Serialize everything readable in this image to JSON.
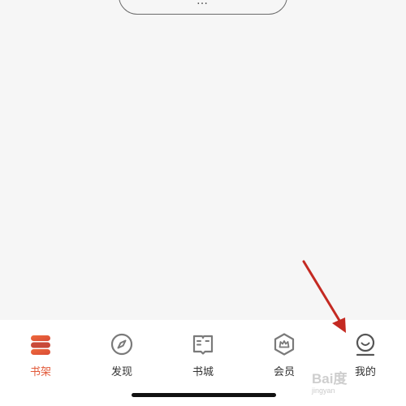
{
  "top_button": {
    "label": "…"
  },
  "tabbar": {
    "items": [
      {
        "label": "书架",
        "icon": "bookshelf-icon",
        "active": true
      },
      {
        "label": "发现",
        "icon": "compass-icon",
        "active": false
      },
      {
        "label": "书城",
        "icon": "book-store-icon",
        "active": false
      },
      {
        "label": "会员",
        "icon": "crown-hexagon-icon",
        "active": false
      },
      {
        "label": "我的",
        "icon": "smile-profile-icon",
        "active": false
      }
    ]
  },
  "watermark": {
    "text": "Bai度",
    "sub": "jingyan"
  },
  "colors": {
    "accent": "#e25a3a",
    "arrow": "#c42a22",
    "icon": "#7a7a7a"
  }
}
